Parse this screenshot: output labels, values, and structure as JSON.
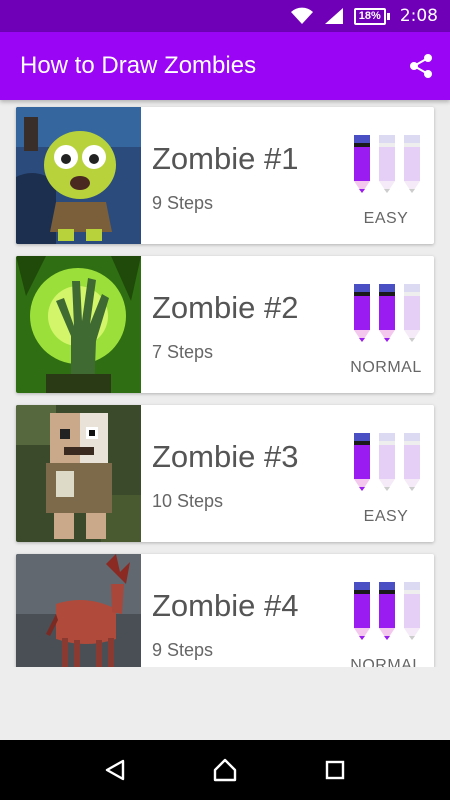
{
  "status_bar": {
    "battery": "18%",
    "time": "2:08",
    "icons": [
      "wifi-icon",
      "signal-icon",
      "battery-icon"
    ]
  },
  "app_bar": {
    "title": "How to Draw Zombies",
    "share_icon": "share-icon"
  },
  "colors": {
    "status_bar": "#6f00b8",
    "app_bar": "#9a05f5",
    "pencil_active": "#9b1cf0",
    "pencil_inactive": "#e6cff7"
  },
  "items": [
    {
      "title": "Zombie #1",
      "steps": "9 Steps",
      "difficulty": "EASY",
      "level": 1,
      "max_level": 3
    },
    {
      "title": "Zombie #2",
      "steps": "7 Steps",
      "difficulty": "NORMAL",
      "level": 2,
      "max_level": 3
    },
    {
      "title": "Zombie #3",
      "steps": "10 Steps",
      "difficulty": "EASY",
      "level": 1,
      "max_level": 3
    },
    {
      "title": "Zombie #4",
      "steps": "9 Steps",
      "difficulty": "NORMAL",
      "level": 2,
      "max_level": 3
    }
  ],
  "nav_bar": {
    "buttons": [
      "back-icon",
      "home-icon",
      "recents-icon"
    ]
  }
}
